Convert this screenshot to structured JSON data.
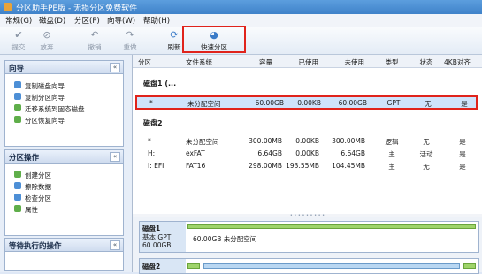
{
  "window": {
    "title": "分区助手PE版 - 无损分区免费软件"
  },
  "menu": [
    "常规(G)",
    "磁盘(D)",
    "分区(P)",
    "向导(W)",
    "帮助(H)"
  ],
  "toolbar": {
    "items": [
      {
        "label": "提交",
        "icon": "commit-icon"
      },
      {
        "label": "放弃",
        "icon": "discard-icon"
      },
      {
        "label": "撤销",
        "icon": "undo-icon"
      },
      {
        "label": "重做",
        "icon": "redo-icon"
      },
      {
        "label": "刷新",
        "icon": "refresh-icon"
      },
      {
        "label": "快速分区",
        "icon": "quick-partition-icon"
      }
    ]
  },
  "sidebar": {
    "wizard": {
      "title": "向导",
      "collapse": "«",
      "items": [
        "复制磁盘向导",
        "复制分区向导",
        "迁移系统到固态磁盘",
        "分区恢复向导"
      ]
    },
    "partition_ops": {
      "title": "分区操作",
      "collapse": "«",
      "items": [
        "创建分区",
        "擦除数据",
        "检查分区",
        "属性"
      ]
    },
    "pending": {
      "title": "等待执行的操作",
      "collapse": "«"
    }
  },
  "table": {
    "headers": [
      "分区",
      "文件系统",
      "容量",
      "已使用",
      "未使用",
      "类型",
      "状态",
      "4KB对齐"
    ],
    "disk1": {
      "title": "磁盘1 (...",
      "rows": [
        [
          "*",
          "未分配空间",
          "60.00GB",
          "0.00KB",
          "60.00GB",
          "GPT",
          "无",
          "是"
        ]
      ]
    },
    "disk2": {
      "title": "磁盘2",
      "rows": [
        [
          "*",
          "未分配空间",
          "300.00MB",
          "0.00KB",
          "300.00MB",
          "逻辑",
          "无",
          "是"
        ],
        [
          "H:",
          "exFAT",
          "6.64GB",
          "0.00KB",
          "6.64GB",
          "主",
          "活动",
          "是"
        ],
        [
          "I: EFI",
          "FAT16",
          "298.00MB",
          "193.55MB",
          "104.45MB",
          "主",
          "无",
          "是"
        ]
      ]
    }
  },
  "disk_map": {
    "disk1": {
      "name": "磁盘1",
      "type": "基本 GPT",
      "size": "60.00GB",
      "partition_label": "60.00GB 未分配空间"
    },
    "disk2": {
      "name": "磁盘2"
    }
  },
  "colors": {
    "accent": "#3f82c9",
    "highlight": "#e0231b",
    "unallocated": "#9fd46a"
  }
}
